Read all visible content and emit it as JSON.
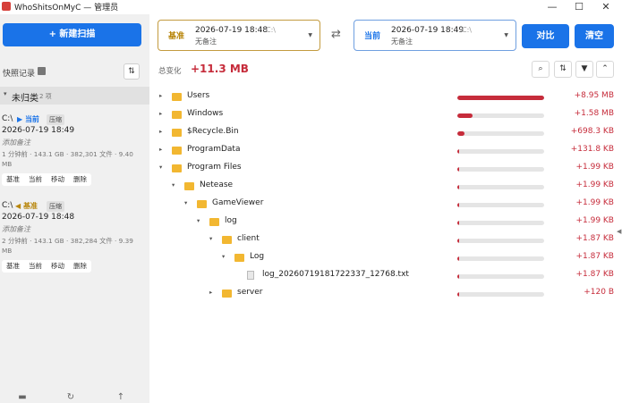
{
  "window": {
    "title": "WhoShitsOnMyC — 管理员",
    "controls": [
      "—",
      "☐",
      "✕"
    ]
  },
  "sidebar": {
    "new_scan_label": "+ 新建扫描",
    "snapshots_title": "快照记录",
    "group": {
      "name": "未归类",
      "count": "2 项"
    },
    "snapshots": [
      {
        "drive": "C:\\",
        "tag": "▶ 当前",
        "tag_color": "#1a73e8",
        "badge": "压缩",
        "time": "2026-07-19 18:49",
        "note": "添加备注",
        "info": "1 分钟前 · 143.1 GB · 382,301 文件 · 9.40 MB",
        "actions": [
          "基准",
          "当前",
          "移动",
          "删除"
        ]
      },
      {
        "drive": "C:\\",
        "tag": "◀ 基准",
        "tag_color": "#b8860b",
        "badge": "压缩",
        "time": "2026-07-19 18:48",
        "note": "添加备注",
        "info": "2 分钟前 · 143.1 GB · 382,284 文件 · 9.39 MB",
        "actions": [
          "基准",
          "当前",
          "移动",
          "删除"
        ]
      }
    ],
    "footer_icons": [
      "folder-icon",
      "refresh-icon",
      "upload-icon"
    ]
  },
  "compare": {
    "base": {
      "label": "基准",
      "date": "2026-07-19 18:48",
      "drive": "C:\\",
      "note": "无备注",
      "color": "#b8860b"
    },
    "current": {
      "label": "当前",
      "date": "2026-07-19 18:49",
      "drive": "C:\\",
      "note": "无备注",
      "color": "#1a73e8"
    },
    "compare_label": "对比",
    "clear_label": "清空"
  },
  "summary": {
    "label": "总变化",
    "value": "+11.3 MB",
    "tools": [
      "search-icon",
      "sort-icon",
      "filter-icon",
      "collapse-icon"
    ]
  },
  "tree": [
    {
      "name": "Users",
      "size": "+8.95 MB",
      "depth": 0,
      "type": "folder",
      "expanded": false,
      "bar": 1.0
    },
    {
      "name": "Windows",
      "size": "+1.58 MB",
      "depth": 0,
      "type": "folder",
      "expanded": false,
      "bar": 0.18
    },
    {
      "name": "$Recycle.Bin",
      "size": "+698.3 KB",
      "depth": 0,
      "type": "folder",
      "expanded": false,
      "bar": 0.08
    },
    {
      "name": "ProgramData",
      "size": "+131.8 KB",
      "depth": 0,
      "type": "folder",
      "expanded": false,
      "bar": 0.015
    },
    {
      "name": "Program Files",
      "size": "+1.99 KB",
      "depth": 0,
      "type": "folder",
      "expanded": true,
      "bar": 0.01
    },
    {
      "name": "Netease",
      "size": "+1.99 KB",
      "depth": 1,
      "type": "folder",
      "expanded": true,
      "bar": 0.01
    },
    {
      "name": "GameViewer",
      "size": "+1.99 KB",
      "depth": 2,
      "type": "folder",
      "expanded": true,
      "bar": 0.01
    },
    {
      "name": "log",
      "size": "+1.99 KB",
      "depth": 3,
      "type": "folder",
      "expanded": true,
      "bar": 0.01
    },
    {
      "name": "client",
      "size": "+1.87 KB",
      "depth": 4,
      "type": "folder",
      "expanded": true,
      "bar": 0.01
    },
    {
      "name": "Log",
      "size": "+1.87 KB",
      "depth": 5,
      "type": "folder",
      "expanded": true,
      "bar": 0.01
    },
    {
      "name": "log_20260719181722337_12768.txt",
      "size": "+1.87 KB",
      "depth": 6,
      "type": "file",
      "expanded": false,
      "bar": 0.01
    },
    {
      "name": "server",
      "size": "+120 B",
      "depth": 4,
      "type": "folder",
      "expanded": false,
      "bar": 0.005
    }
  ]
}
